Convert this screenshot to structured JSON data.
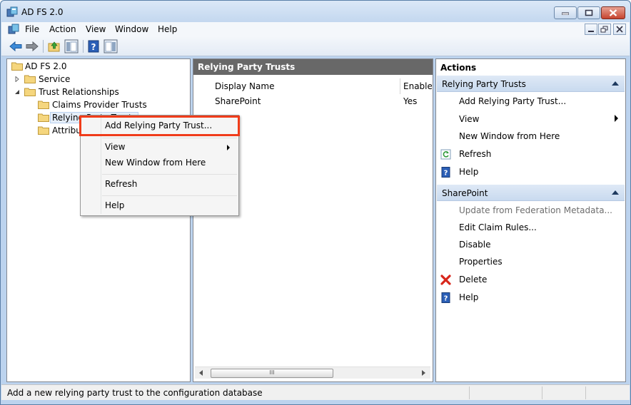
{
  "window": {
    "title": "AD FS 2.0"
  },
  "menu": [
    "File",
    "Action",
    "View",
    "Window",
    "Help"
  ],
  "tree": {
    "root": "AD FS 2.0",
    "items": [
      {
        "label": "Service"
      },
      {
        "label": "Trust Relationships"
      },
      {
        "label": "Claims Provider Trusts"
      },
      {
        "label": "Relying Party Trusts"
      },
      {
        "label": "Attribute Stores"
      }
    ]
  },
  "center": {
    "header": "Relying Party Trusts",
    "columns": [
      "Display Name",
      "Enabled"
    ],
    "rows": [
      {
        "name": "SharePoint",
        "enabled": "Yes"
      }
    ],
    "scroll_grip": "III"
  },
  "actions": {
    "title": "Actions",
    "sections": [
      {
        "title": "Relying Party Trusts",
        "items": [
          "Add Relying Party Trust...",
          "View",
          "New Window from Here",
          "Refresh",
          "Help"
        ]
      },
      {
        "title": "SharePoint",
        "items": [
          "Update from Federation Metadata...",
          "Edit Claim Rules...",
          "Disable",
          "Properties",
          "Delete",
          "Help"
        ]
      }
    ]
  },
  "context_menu": {
    "items": [
      "Add Relying Party Trust...",
      "View",
      "New Window from Here",
      "Refresh",
      "Help"
    ]
  },
  "status": {
    "text": "Add a new relying party trust to the configuration database"
  },
  "colors": {
    "highlight": "#f03c1a",
    "pane_header": "#686868",
    "section_header": "#c9daef"
  }
}
